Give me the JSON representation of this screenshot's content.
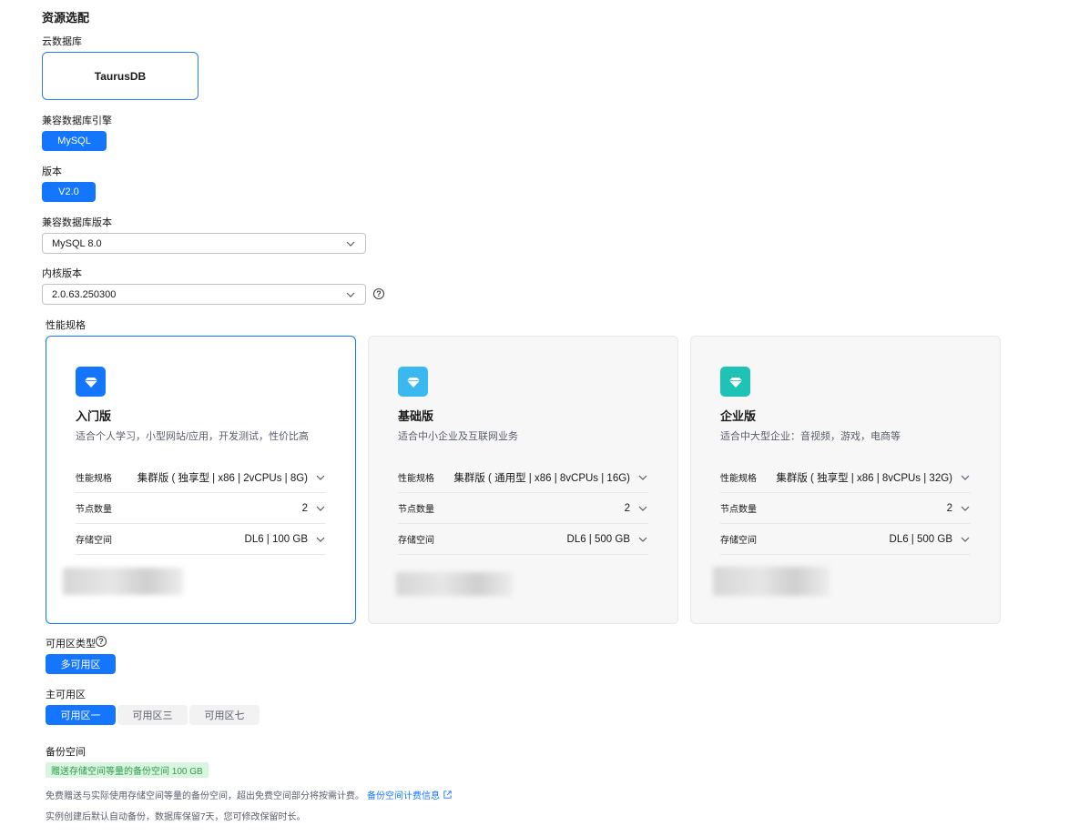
{
  "section": {
    "title": "资源选配"
  },
  "cloud_db": {
    "label": "云数据库",
    "option": "TaurusDB"
  },
  "engine": {
    "label": "兼容数据库引擎",
    "option": "MySQL"
  },
  "version": {
    "label": "版本",
    "option": "V2.0"
  },
  "db_version": {
    "label": "兼容数据库版本",
    "value": "MySQL 8.0"
  },
  "kernel": {
    "label": "内核版本",
    "value": "2.0.63.250300"
  },
  "performance": {
    "label": "性能规格",
    "cards": [
      {
        "name": "入门版",
        "desc": "适合个人学习，小型网站/应用，开发测试，性价比高",
        "icon": "diamond-icon",
        "icon_color": "#1476ff",
        "selected": true,
        "rows": [
          {
            "label": "性能规格",
            "value": "集群版 ( 独享型 | x86 | 2vCPUs | 8G)"
          },
          {
            "label": "节点数量",
            "value": "2"
          },
          {
            "label": "存储空间",
            "value": "DL6 | 100 GB"
          }
        ]
      },
      {
        "name": "基础版",
        "desc": "适合中小企业及互联网业务",
        "icon": "diamond-icon",
        "icon_color": "#3ab8f0",
        "selected": false,
        "rows": [
          {
            "label": "性能规格",
            "value": "集群版 ( 通用型 | x86 | 8vCPUs | 16G)"
          },
          {
            "label": "节点数量",
            "value": "2"
          },
          {
            "label": "存储空间",
            "value": "DL6 | 500 GB"
          }
        ]
      },
      {
        "name": "企业版",
        "desc": "适合中大型企业：音视频，游戏，电商等",
        "icon": "diamond-icon",
        "icon_color": "#1fc3b6",
        "selected": false,
        "rows": [
          {
            "label": "性能规格",
            "value": "集群版 ( 独享型 | x86 | 8vCPUs | 32G)"
          },
          {
            "label": "节点数量",
            "value": "2"
          },
          {
            "label": "存储空间",
            "value": "DL6 | 500 GB"
          }
        ]
      }
    ]
  },
  "az_type": {
    "label": "可用区类型",
    "option": "多可用区"
  },
  "primary_az": {
    "label": "主可用区",
    "options": [
      "可用区一",
      "可用区三",
      "可用区七"
    ],
    "selected": "可用区一"
  },
  "backup": {
    "label": "备份空间",
    "badge": "赠送存储空间等量的备份空间 100 GB",
    "note1": "免费赠送与实际使用存储空间等量的备份空间，超出免费空间部分将按需计费。",
    "note1_link": "备份空间计费信息",
    "note2": "实例创建后默认自动备份，数据库保留7天，您可修改保留时长。"
  }
}
